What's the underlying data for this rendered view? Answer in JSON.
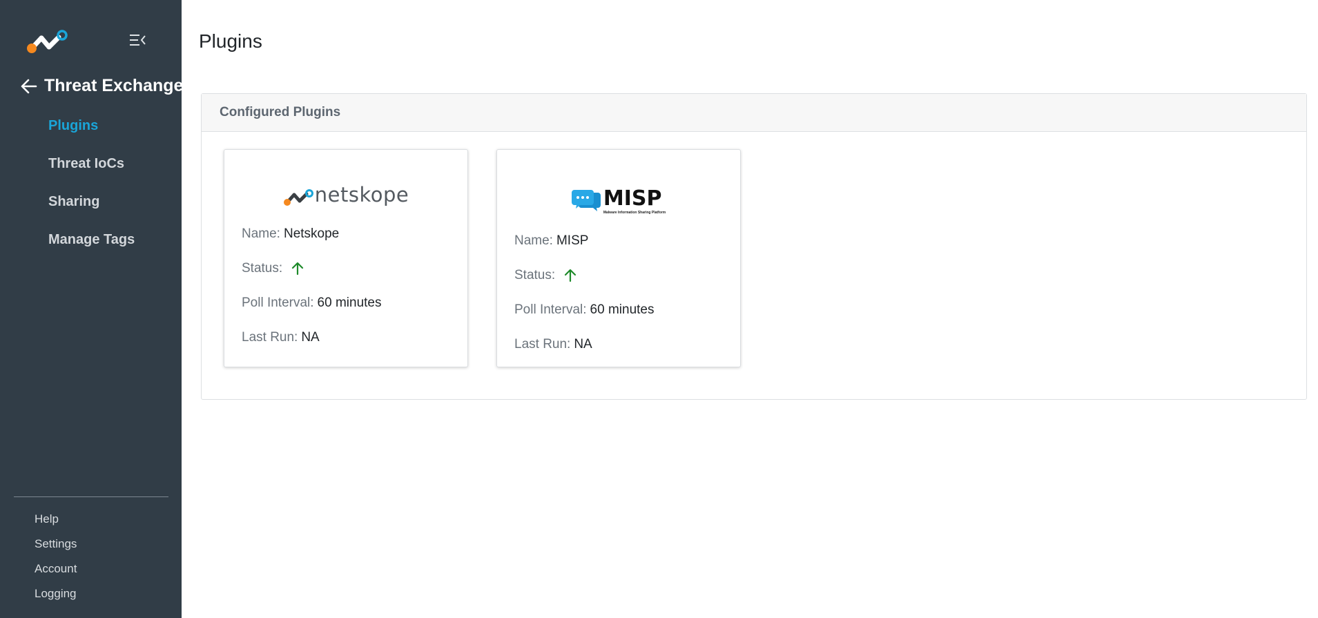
{
  "sidebar": {
    "section_title": "Threat Exchange",
    "nav_items": [
      {
        "label": "Plugins",
        "active": true
      },
      {
        "label": "Threat IoCs",
        "active": false
      },
      {
        "label": "Sharing",
        "active": false
      },
      {
        "label": "Manage Tags",
        "active": false
      }
    ],
    "bottom_items": [
      {
        "label": "Help"
      },
      {
        "label": "Settings"
      },
      {
        "label": "Account"
      },
      {
        "label": "Logging"
      }
    ]
  },
  "page": {
    "title": "Plugins"
  },
  "panel": {
    "title": "Configured Plugins",
    "plugins": [
      {
        "logo_text": "netskope",
        "name_label": "Name:",
        "name": "Netskope",
        "status_label": "Status:",
        "status_icon": "arrow-up-icon",
        "poll_label": "Poll Interval:",
        "poll_interval": "60 minutes",
        "last_run_label": "Last Run:",
        "last_run": "NA"
      },
      {
        "logo_text": "MISP",
        "logo_subtext": "Malware Information Sharing Platform",
        "name_label": "Name:",
        "name": "MISP",
        "status_label": "Status:",
        "status_icon": "arrow-up-icon",
        "poll_label": "Poll Interval:",
        "poll_interval": "60 minutes",
        "last_run_label": "Last Run:",
        "last_run": "NA"
      }
    ]
  },
  "colors": {
    "sidebar_bg": "#313d47",
    "active_nav": "#1aa5d8",
    "status_up": "#1e8a2a",
    "brand_orange": "#f5891f",
    "brand_blue": "#1aa5d8"
  }
}
